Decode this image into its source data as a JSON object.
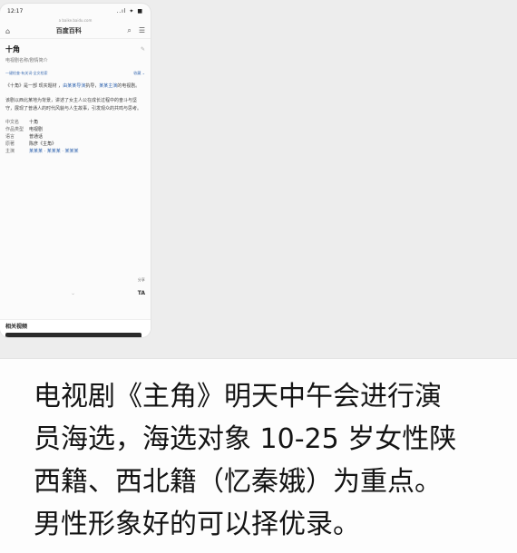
{
  "phone": {
    "status": {
      "time": "12:17",
      "icons": "..ıl ✦ ■"
    },
    "url": "a baike.baidu.com",
    "nav": {
      "title": "百度百科"
    },
    "entry": {
      "title": "十角",
      "subtitle": "电视剧名称/剧情简介",
      "meta_left": "一键检查·有关词·全文检索",
      "meta_right": "收藏 ⌄",
      "para1_a": "《十角》是一部 现实题材 ，",
      "para1_link1": "由某某导演",
      "para1_b": "执导，",
      "para1_link2": "某某主演",
      "para1_c": "的电视剧。",
      "para2": "该剧以西北某地为背景，讲述了女主人公在成长过程中的奋斗与坚守，展现了普通人的时代风貌与人生故事，引发观众的共鸣与思考。"
    },
    "info": [
      {
        "k": "中文名",
        "v": "十角",
        "link": false
      },
      {
        "k": "作品类型",
        "v": "电视剧",
        "link": false
      },
      {
        "k": "语言",
        "v": "普通话",
        "link": false
      },
      {
        "k": "原著",
        "v": "陈彦《主角》",
        "link": false
      },
      {
        "k": "主演",
        "v": "某某某 · 某某某 · 某某某",
        "link": true
      }
    ],
    "side": {
      "small_label": "分享",
      "ta_label": "TA"
    },
    "related": {
      "title": "相关视频"
    }
  },
  "caption": {
    "line1": "电视剧《主角》明天中午会进行演",
    "line2": "员海选，海选对象 10-25 岁女性陕",
    "line3": "西籍、西北籍（忆秦娥）为重点。",
    "line4": "男性形象好的可以择优录。"
  }
}
